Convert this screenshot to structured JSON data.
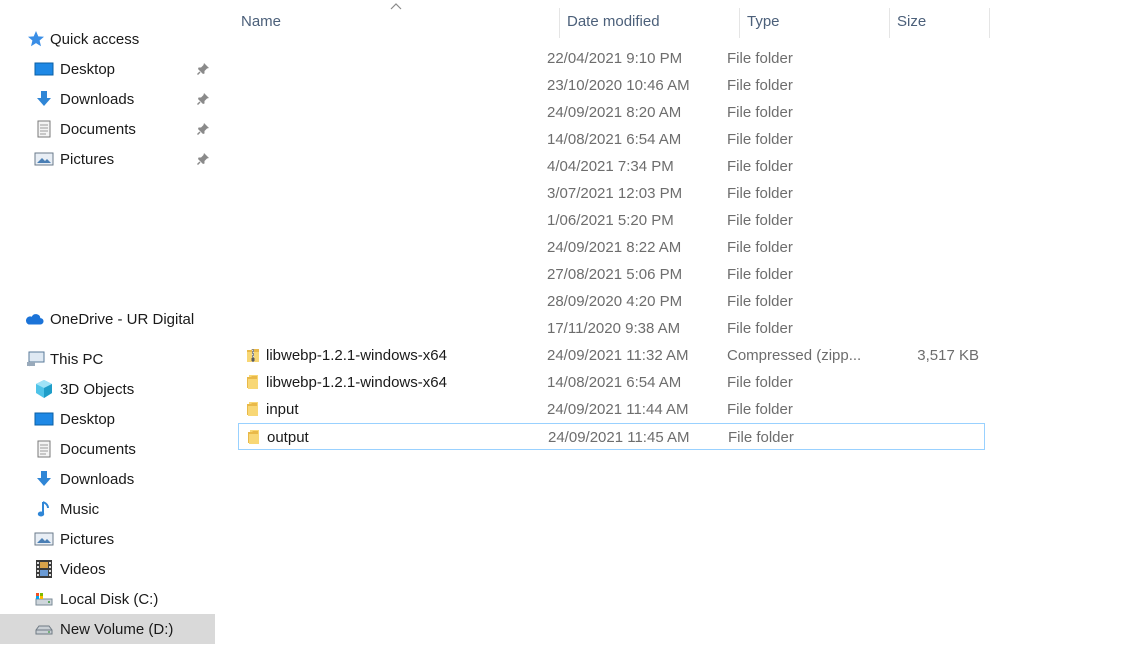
{
  "sidebar": {
    "quick_access": {
      "label": "Quick access",
      "items": [
        {
          "label": "Desktop",
          "icon": "desktop-icon",
          "pinned": true
        },
        {
          "label": "Downloads",
          "icon": "downloads-icon",
          "pinned": true
        },
        {
          "label": "Documents",
          "icon": "documents-icon",
          "pinned": true
        },
        {
          "label": "Pictures",
          "icon": "pictures-icon",
          "pinned": true
        }
      ]
    },
    "onedrive": {
      "label": "OneDrive - UR Digital",
      "icon": "onedrive-icon"
    },
    "this_pc": {
      "label": "This PC",
      "items": [
        {
          "label": "3D Objects",
          "icon": "3d-objects-icon"
        },
        {
          "label": "Desktop",
          "icon": "desktop-icon"
        },
        {
          "label": "Documents",
          "icon": "documents-icon"
        },
        {
          "label": "Downloads",
          "icon": "downloads-icon"
        },
        {
          "label": "Music",
          "icon": "music-icon"
        },
        {
          "label": "Pictures",
          "icon": "pictures-icon"
        },
        {
          "label": "Videos",
          "icon": "videos-icon"
        },
        {
          "label": "Local Disk (C:)",
          "icon": "local-disk-icon"
        },
        {
          "label": "New Volume (D:)",
          "icon": "drive-icon",
          "selected": true
        }
      ]
    }
  },
  "columns": {
    "name": "Name",
    "date": "Date modified",
    "type": "Type",
    "size": "Size"
  },
  "files": [
    {
      "name": "",
      "date": "22/04/2021 9:10 PM",
      "type": "File folder",
      "size": ""
    },
    {
      "name": "",
      "date": "23/10/2020 10:46 AM",
      "type": "File folder",
      "size": ""
    },
    {
      "name": "",
      "date": "24/09/2021 8:20 AM",
      "type": "File folder",
      "size": ""
    },
    {
      "name": "",
      "date": "14/08/2021 6:54 AM",
      "type": "File folder",
      "size": ""
    },
    {
      "name": "",
      "date": "4/04/2021 7:34 PM",
      "type": "File folder",
      "size": ""
    },
    {
      "name": "",
      "date": "3/07/2021 12:03 PM",
      "type": "File folder",
      "size": ""
    },
    {
      "name": "",
      "date": "1/06/2021 5:20 PM",
      "type": "File folder",
      "size": ""
    },
    {
      "name": "",
      "date": "24/09/2021 8:22 AM",
      "type": "File folder",
      "size": ""
    },
    {
      "name": "",
      "date": "27/08/2021 5:06 PM",
      "type": "File folder",
      "size": ""
    },
    {
      "name": "",
      "date": "28/09/2020 4:20 PM",
      "type": "File folder",
      "size": ""
    },
    {
      "name": "",
      "date": "17/11/2020 9:38 AM",
      "type": "File folder",
      "size": ""
    },
    {
      "name": "libwebp-1.2.1-windows-x64",
      "date": "24/09/2021 11:32 AM",
      "type": "Compressed (zipp...",
      "size": "3,517 KB",
      "icon": "zip-folder-icon"
    },
    {
      "name": "libwebp-1.2.1-windows-x64",
      "date": "14/08/2021 6:54 AM",
      "type": "File folder",
      "size": "",
      "icon": "folder-icon"
    },
    {
      "name": "input",
      "date": "24/09/2021 11:44 AM",
      "type": "File folder",
      "size": "",
      "icon": "folder-icon"
    },
    {
      "name": "output",
      "date": "24/09/2021 11:45 AM",
      "type": "File folder",
      "size": "",
      "icon": "folder-icon",
      "focused": true
    }
  ],
  "colors": {
    "header_text": "#4c607a",
    "selected_bg": "#d9d9d9",
    "focus_border": "#99d1ff",
    "folder_yellow": "#f8d775"
  }
}
